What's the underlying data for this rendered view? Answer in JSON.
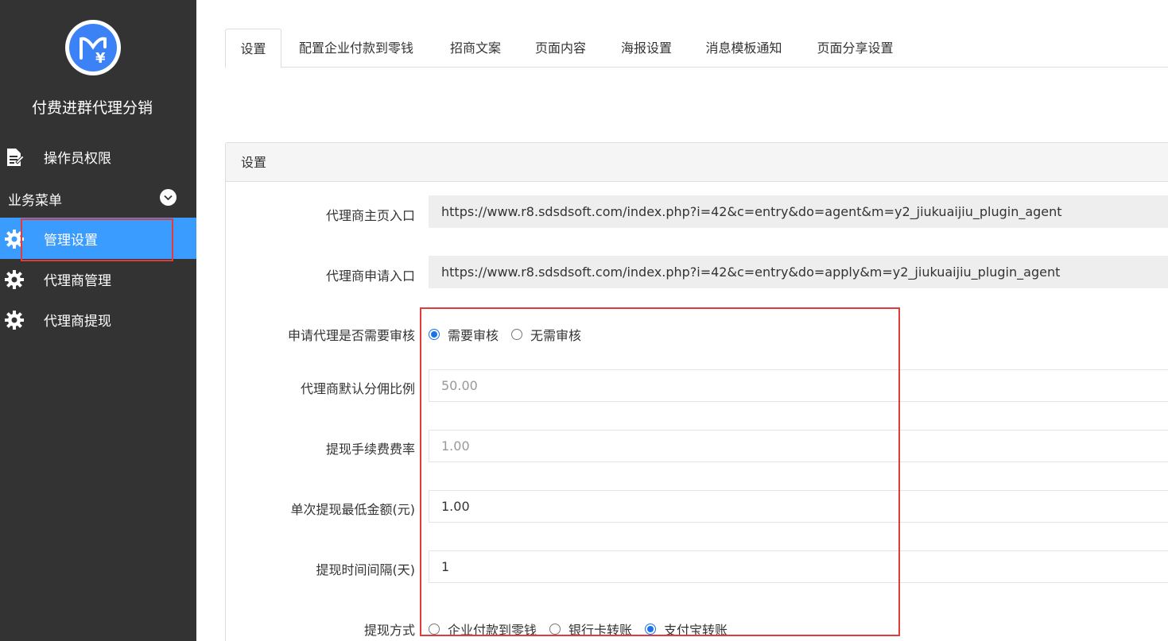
{
  "sidebar": {
    "app_title": "付费进群代理分销",
    "logo_icon": "wallet-yen-logo",
    "items": [
      {
        "label": "操作员权限",
        "icon": "document-icon"
      },
      {
        "label": "管理设置",
        "icon": "gear-icon",
        "active": true
      },
      {
        "label": "代理商管理",
        "icon": "gear-icon"
      },
      {
        "label": "代理商提现",
        "icon": "gear-icon"
      }
    ],
    "group_title": "业务菜单"
  },
  "tabs": [
    {
      "label": "设置",
      "active": true
    },
    {
      "label": "配置企业付款到零钱"
    },
    {
      "label": "招商文案"
    },
    {
      "label": "页面内容"
    },
    {
      "label": "海报设置"
    },
    {
      "label": "消息模板通知"
    },
    {
      "label": "页面分享设置"
    }
  ],
  "panel": {
    "title": "设置",
    "agent_home_entry": {
      "label": "代理商主页入口",
      "value": "https://www.r8.sdsdsoft.com/index.php?i=42&c=entry&do=agent&m=y2_jiukuaijiu_plugin_agent"
    },
    "agent_apply_entry": {
      "label": "代理商申请入口",
      "value": "https://www.r8.sdsdsoft.com/index.php?i=42&c=entry&do=apply&m=y2_jiukuaijiu_plugin_agent"
    },
    "review_required": {
      "label": "申请代理是否需要审核",
      "options": [
        "需要审核",
        "无需审核"
      ],
      "selected": "需要审核"
    },
    "default_commission": {
      "label": "代理商默认分佣比例",
      "value": "50.00"
    },
    "fee_rate": {
      "label": "提现手续费费率",
      "value": "1.00"
    },
    "min_amount": {
      "label": "单次提现最低金额(元)",
      "value": "1.00"
    },
    "interval": {
      "label": "提现时间间隔(天)",
      "value": "1"
    },
    "withdraw_method": {
      "label": "提现方式",
      "options": [
        "企业付款到零钱",
        "银行卡转账",
        "支付宝转账"
      ],
      "selected": "支付宝转账"
    }
  },
  "colors": {
    "sidebar_bg": "#333333",
    "active": "#3b9cff",
    "highlight": "#e23b3b"
  }
}
